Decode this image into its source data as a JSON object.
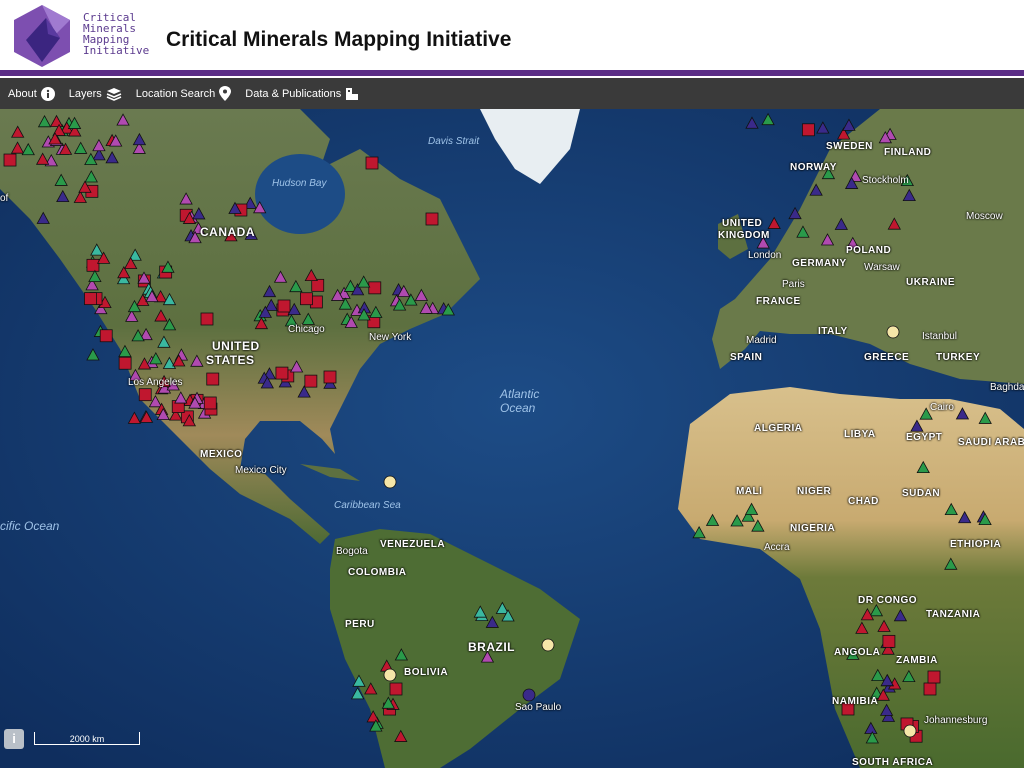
{
  "header": {
    "logo_text": [
      "Critical",
      "Minerals",
      "Mapping",
      "Initiative"
    ],
    "title": "Critical Minerals Mapping Initiative"
  },
  "nav": {
    "about": "About",
    "layers": "Layers",
    "location_search": "Location Search",
    "data_publications": "Data & Publications"
  },
  "map": {
    "scale_label": "2000 km",
    "info_label": "i",
    "labels": [
      "Davis Strait",
      "Hudson Bay",
      "CANADA",
      "UNITED",
      "STATES",
      "Chicago",
      "New York",
      "Los Angeles",
      "MEXICO",
      "Mexico City",
      "Caribbean Sea",
      "Atlantic",
      "Ocean",
      "cific Ocean",
      "Bogota",
      "VENEZUELA",
      "COLOMBIA",
      "PERU",
      "BRAZIL",
      "BOLIVIA",
      "Sao Paulo",
      "SWEDEN",
      "FINLAND",
      "NORWAY",
      "Stockholm",
      "Moscow",
      "UNITED",
      "KINGDOM",
      "London",
      "GERMANY",
      "POLAND",
      "Warsaw",
      "UKRAINE",
      "Paris",
      "FRANCE",
      "ITALY",
      "Madrid",
      "SPAIN",
      "Istanbul",
      "GREECE",
      "TURKEY",
      "Baghda",
      "Cairo",
      "ALGERIA",
      "LIBYA",
      "EGYPT",
      "SAUDI ARAB",
      "MALI",
      "NIGER",
      "CHAD",
      "SUDAN",
      "NIGERIA",
      "Accra",
      "ETHIOPIA",
      "DR CONGO",
      "TANZANIA",
      "ANGOLA",
      "ZAMBIA",
      "NAMIBIA",
      "Johannesburg",
      "SOUTH AFRICA",
      "of"
    ],
    "marker_colors": {
      "red": "#c0172f",
      "purple": "#3a2a8a",
      "magenta": "#b04ab0",
      "green": "#2a9a4a",
      "teal": "#3ab8a0",
      "yellow": "#f5e6a8"
    }
  }
}
